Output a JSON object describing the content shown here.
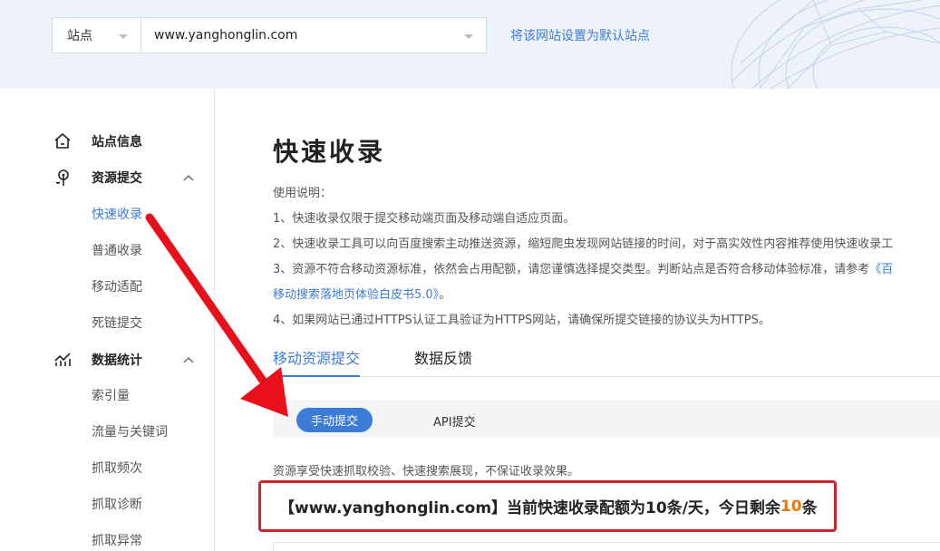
{
  "header": {
    "site_type": "站点",
    "site_url": "www.yanghonglin.com",
    "set_default_link": "将该网站设置为默认站点"
  },
  "sidebar": {
    "groups": [
      {
        "label": "站点信息",
        "icon": "home-icon"
      },
      {
        "label": "资源提交",
        "icon": "resource-submit-icon",
        "expanded": true,
        "items": [
          "快速收录",
          "普通收录",
          "移动适配",
          "死链提交"
        ]
      },
      {
        "label": "数据统计",
        "icon": "stats-chart-icon",
        "expanded": true,
        "items": [
          "索引量",
          "流量与关键词",
          "抓取频次",
          "抓取诊断",
          "抓取异常"
        ]
      }
    ],
    "active_item": "快速收录"
  },
  "main": {
    "title": "快速收录",
    "instructions": {
      "heading": "使用说明：",
      "line1": "1、快速收录仅限于提交移动端页面及移动端自适应页面。",
      "line2": "2、快速收录工具可以向百度搜索主动推送资源，缩短爬虫发现网站链接的时间，对于高实效性内容推荐使用快速收录工",
      "line3_text": "3、资源不符合移动资源标准，依然会占用配额，请您谨慎选择提交类型。判断站点是否符合移动体验标准，请参考",
      "line3_link": "《百",
      "line3_cont_link": "移动搜索落地页体验白皮书5.0》",
      "line3_cont_end": "。",
      "line4": "4、如果网站已通过HTTPS认证工具验证为HTTPS网站，请确保所提交链接的协议头为HTTPS。"
    },
    "tabs": [
      "移动资源提交",
      "数据反馈"
    ],
    "active_tab": "移动资源提交",
    "subtabs": [
      "手动提交",
      "API提交"
    ],
    "active_subtab": "手动提交",
    "notice": "资源享受快速抓取校验、快速搜索展现，不保证收录效果。",
    "quota": {
      "prefix": "【www.yanghonglin.com】当前快速收录配额为10条/天，今日剩余",
      "remaining": "10",
      "suffix": "条"
    }
  },
  "colors": {
    "accent": "#3c7bd6",
    "highlight_border": "#d0242e",
    "arrow": "#e8111b",
    "remaining_number": "#e8760e"
  }
}
